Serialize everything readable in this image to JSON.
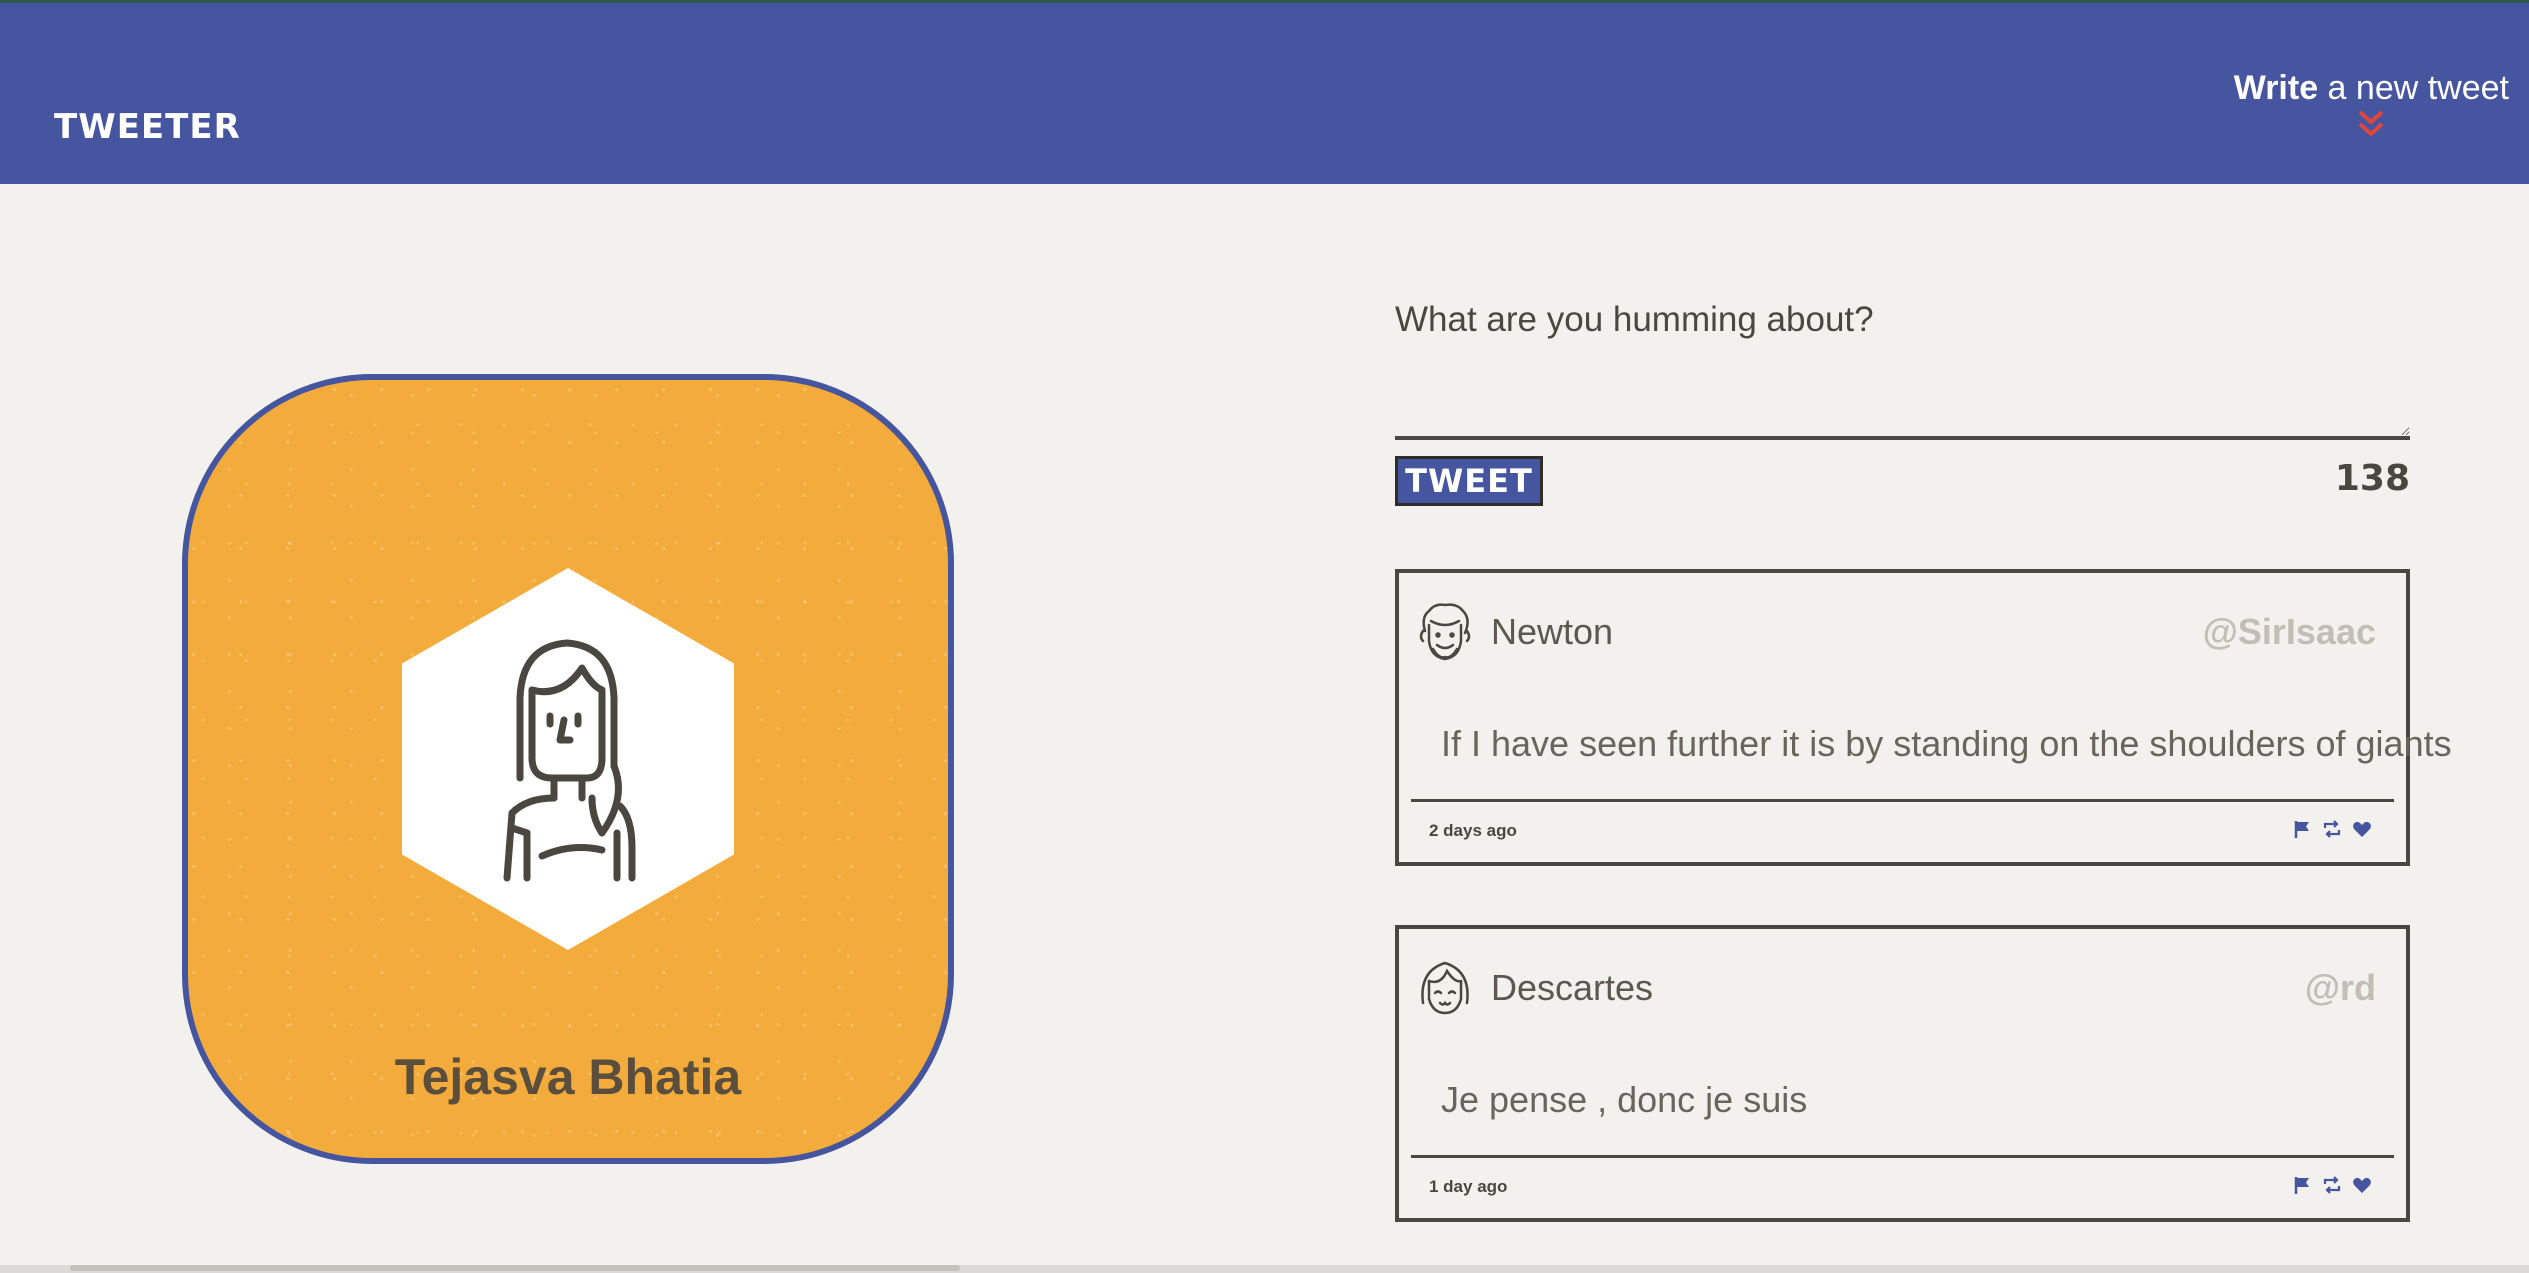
{
  "nav": {
    "brand": "TWEETER",
    "compose_bold": "Write",
    "compose_rest": " a new tweet"
  },
  "profile": {
    "name": "Tejasva Bhatia"
  },
  "compose": {
    "placeholder": "What are you humming about?",
    "button_label": "TWEET",
    "char_count": "138"
  },
  "tweets": [
    {
      "name": "Newton",
      "handle": "@SirIsaac",
      "content": "If I have seen further it is by standing on the shoulders of giants",
      "time": "2 days ago"
    },
    {
      "name": "Descartes",
      "handle": "@rd",
      "content": "Je pense , donc je suis",
      "time": "1 day ago"
    }
  ],
  "colors": {
    "nav_bg": "#4655a0",
    "page_bg": "#f3f1ed",
    "profile_bg": "#f3ac3c",
    "accent_red": "#e2463b",
    "text_dark": "#4a4740"
  },
  "icons": {
    "chevron": "double-chevron-down-icon",
    "flag": "flag-icon",
    "retweet": "retweet-icon",
    "like": "heart-icon"
  }
}
